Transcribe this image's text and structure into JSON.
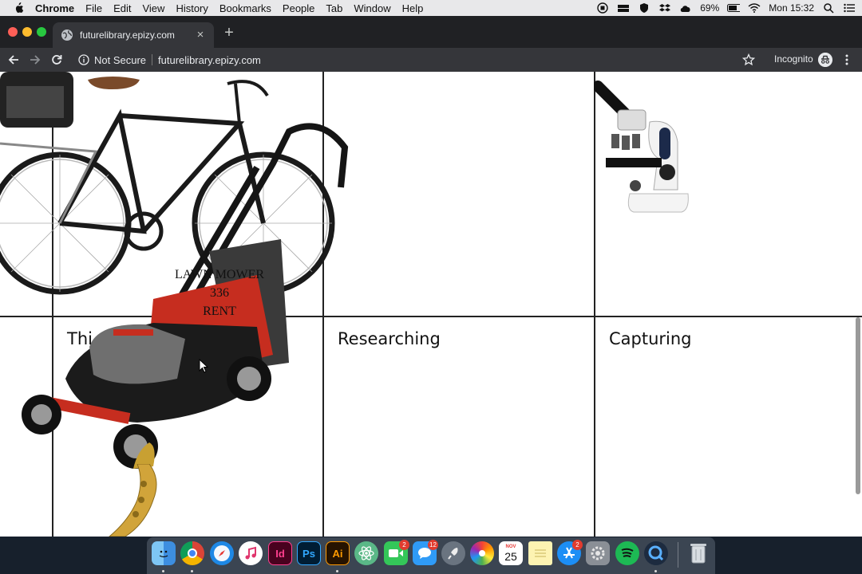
{
  "menubar": {
    "app_name": "Chrome",
    "items": [
      "File",
      "Edit",
      "View",
      "History",
      "Bookmarks",
      "People",
      "Tab",
      "Window",
      "Help"
    ],
    "battery": "69%",
    "clock": "Mon 15:32"
  },
  "browser": {
    "tab_title": "futurelibrary.epizy.com",
    "security_text": "Not Secure",
    "url": "futurelibrary.epizy.com",
    "incognito_label": "Incognito"
  },
  "page": {
    "cells": [
      "Thi",
      "Researching",
      "Capturing"
    ],
    "mower_caption": [
      "LAWN MOWER",
      "336",
      "RENT"
    ]
  },
  "dock": {
    "icons": [
      "finder-icon",
      "chrome-icon",
      "safari-icon",
      "itunes-icon",
      "indesign-icon",
      "photoshop-icon",
      "illustrator-icon",
      "atom-icon",
      "facetime-icon",
      "messages-icon",
      "launchpad-icon",
      "photos-icon",
      "calendar-icon",
      "notes-icon",
      "app-store-icon",
      "system-preferences-icon",
      "spotify-icon",
      "quicktime-icon",
      "trash-icon"
    ],
    "indesign_label": "Id",
    "photoshop_label": "Ps",
    "illustrator_label": "Ai",
    "facetime_badge": "2",
    "messages_badge": "12",
    "calendar_month": "NOV",
    "calendar_day": "25",
    "app_store_badge": "2"
  }
}
